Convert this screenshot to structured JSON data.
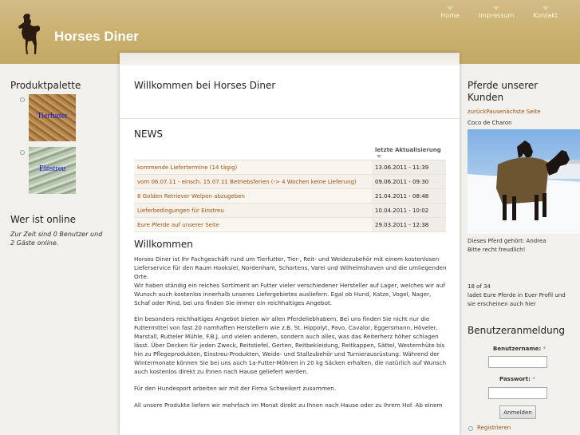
{
  "site": {
    "title": "Horses Diner"
  },
  "nav": [
    {
      "label": "Home"
    },
    {
      "label": "Impressum"
    },
    {
      "label": "Kontakt"
    }
  ],
  "left": {
    "produkt_title": "Produktpalette",
    "products": [
      {
        "label": "Tierfutter"
      },
      {
        "label": "Einstreu"
      }
    ],
    "online_title": "Wer ist online",
    "online_pre": "Zur Zeit sind ",
    "online_users": "0 Benutzer",
    "online_mid": " und ",
    "online_guests": "2 Gäste",
    "online_post": " online."
  },
  "main": {
    "title": "Willkommen bei Horses Diner",
    "news_title": "NEWS",
    "news_col": "letzte Aktualisierung",
    "news": [
      {
        "title": "kommende Liefertermine (14 tägig)",
        "date": "13.06.2011 - 11:39"
      },
      {
        "title": "vom 06.07.11 - einsch. 15.07.11 Betriebsferien (-> 4 Wochen keine Lieferung)",
        "date": "09.06.2011 - 09:30"
      },
      {
        "title": "8 Golden Retriever Welpen abzugeben",
        "date": "21.04.2011 - 08:48"
      },
      {
        "title": "Lieferbedingungen für Einstreu",
        "date": "10.04.2011 - 10:02"
      },
      {
        "title": "Eure Pferde auf unserer Seite",
        "date": "29.03.2011 - 12:38"
      }
    ],
    "welcome_title": "Willkommen",
    "p1": "Horses Diner ist Ihr Fachgeschäft rund um Tierfutter, Tier-, Reit- und Weidezubehör mit einem kostenlosen Lieferservice für den Raum  Hooksiel, Nordenham, Schortens, Varel und Wilhelmshaven und die umliegenden Orte.",
    "p1b": "Wir haben ständig ein reiches Sortiment an Futter vieler verschiedener Hersteller auf Lager, welches wir auf Wunsch auch kostenlos innerhalb unseres Liefergebietes ausliefern. Egal ob Hund, Katze, Vogel, Nager, Schaf oder Rind, bei uns finden Sie immer ein reichhaltiges Angebot.",
    "p2": "Ein besonders reichhaltiges Angebot bieten wir allen Pferdeliebhabern. Bei uns finden Sie nicht nur die Futtermittel von fast 20 namhaften Herstellern wie z.B. St. Hippolyt, Pavo, Cavalor, Eggersmann, Höveler, Marstall, Rutteler Mühle, F.B.J, und vielen anderen, sondern auch alles, was das Reiterherz höher schlagen lässt. Über Decken für jeden Zweck, Reitstiefel, Gerten, Reitbekleidung, Reitkappen, Sättel, Westernhüte bis hin zu Pflegeprodukten, Einstreu-Produkten, Weide- und Stallzubehör und Turnierausrüstung. Während der Wintermonate können Sie bei uns auch 1a-Futter-Möhren in 20 kg Säcken erhalten, die natürlich auf Wunsch auch kostenlos direkt zu Ihnen nach Hause geliefert werden.",
    "p3": "Für den Hundesport arbeiten wir mit der Firma Schweikert zusammen.",
    "p4": "All unsere Produkte liefern wir mehrfach im Monat direkt zu Ihnen nach Hause oder zu Ihrem Hof. Ab einem"
  },
  "right": {
    "title": "Pferde unserer Kunden",
    "gallery_nav": "zurückPausenächste Seite",
    "horse_name": "Coco de Charon",
    "caption1": "Dieses Pferd gehört: Andrea",
    "caption2": "Bitte recht freudlich!",
    "counter": "18 of 34",
    "cta": "ladet Eure Pferde in Euer Profil und sie erscheinen auch hier",
    "login_title": "Benutzeranmeldung",
    "user_label": "Benutzername:",
    "pass_label": "Passwort:",
    "required": "*",
    "login_button": "Anmelden",
    "register": "Registrieren"
  }
}
